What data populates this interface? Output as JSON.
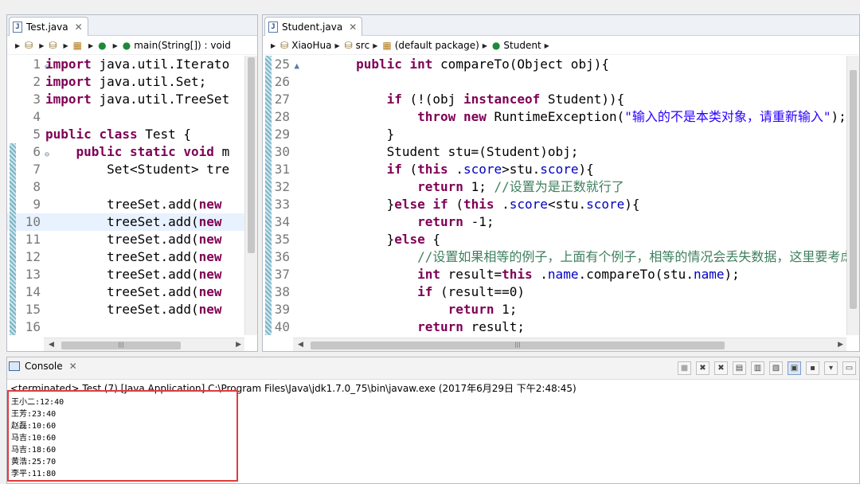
{
  "left_editor": {
    "tab_title": "Test.java",
    "breadcrumb": {
      "last": "main(String[]) : void"
    },
    "lines": [
      {
        "n": "1",
        "t": [
          [
            "kw",
            "import"
          ],
          [
            "",
            "java.util.Iterato"
          ]
        ]
      },
      {
        "n": "2",
        "t": [
          [
            "kw",
            "import"
          ],
          [
            "",
            "java.util.Set;"
          ]
        ]
      },
      {
        "n": "3",
        "t": [
          [
            "kw",
            "import"
          ],
          [
            "",
            "java.util.TreeSet"
          ]
        ]
      },
      {
        "n": "4",
        "t": []
      },
      {
        "n": "5",
        "t": [
          [
            "kw",
            "public"
          ],
          [
            "kw",
            "class"
          ],
          [
            "",
            "Test {"
          ]
        ]
      },
      {
        "n": "6",
        "t": [
          [
            "",
            "    "
          ],
          [
            "kw",
            "public"
          ],
          [
            "kw",
            "static"
          ],
          [
            "kw",
            "void"
          ],
          [
            "",
            "m"
          ]
        ]
      },
      {
        "n": "7",
        "t": [
          [
            "",
            "        Set<Student> tre"
          ]
        ]
      },
      {
        "n": "8",
        "t": []
      },
      {
        "n": "9",
        "t": [
          [
            "",
            "        treeSet.add("
          ],
          [
            "kw",
            "new"
          ]
        ]
      },
      {
        "n": "10",
        "t": [
          [
            "",
            "        treeSet.add("
          ],
          [
            "kw",
            "new"
          ]
        ]
      },
      {
        "n": "11",
        "t": [
          [
            "",
            "        treeSet.add("
          ],
          [
            "kw",
            "new"
          ]
        ]
      },
      {
        "n": "12",
        "t": [
          [
            "",
            "        treeSet.add("
          ],
          [
            "kw",
            "new"
          ]
        ]
      },
      {
        "n": "13",
        "t": [
          [
            "",
            "        treeSet.add("
          ],
          [
            "kw",
            "new"
          ]
        ]
      },
      {
        "n": "14",
        "t": [
          [
            "",
            "        treeSet.add("
          ],
          [
            "kw",
            "new"
          ]
        ]
      },
      {
        "n": "15",
        "t": [
          [
            "",
            "        treeSet.add("
          ],
          [
            "kw",
            "new"
          ]
        ]
      },
      {
        "n": "16",
        "t": []
      }
    ]
  },
  "right_editor": {
    "tab_title": "Student.java",
    "breadcrumb": {
      "project": "XiaoHua",
      "folder": "src",
      "package": "(default package)",
      "class": "Student"
    },
    "lines": [
      {
        "n": "25",
        "t": [
          [
            "",
            "        "
          ],
          [
            "kw",
            "public"
          ],
          [
            "kw",
            "int"
          ],
          [
            "",
            "compareTo(Object obj){"
          ]
        ]
      },
      {
        "n": "26",
        "t": []
      },
      {
        "n": "27",
        "t": [
          [
            "",
            "            "
          ],
          [
            "kw",
            "if"
          ],
          [
            "",
            "(!(obj "
          ],
          [
            "kw",
            "instanceof"
          ],
          [
            "",
            "Student)){"
          ]
        ]
      },
      {
        "n": "28",
        "t": [
          [
            "",
            "                "
          ],
          [
            "kw",
            "throw"
          ],
          [
            "kw",
            "new"
          ],
          [
            "",
            "RuntimeException("
          ],
          [
            "str",
            "\"输入的不是本类对象，请重新输入\""
          ],
          [
            "",
            ");"
          ]
        ]
      },
      {
        "n": "29",
        "t": [
          [
            "",
            "            }"
          ]
        ]
      },
      {
        "n": "30",
        "t": [
          [
            "",
            "            Student stu=(Student)obj;"
          ]
        ]
      },
      {
        "n": "31",
        "t": [
          [
            "",
            "            "
          ],
          [
            "kw",
            "if"
          ],
          [
            "",
            "("
          ],
          [
            "kw",
            "this"
          ],
          [
            "",
            "."
          ],
          [
            "fld",
            "score"
          ],
          [
            "",
            ">stu."
          ],
          [
            "fld",
            "score"
          ],
          [
            "",
            "){"
          ]
        ]
      },
      {
        "n": "32",
        "t": [
          [
            "",
            "                "
          ],
          [
            "kw",
            "return"
          ],
          [
            "",
            "1; "
          ],
          [
            "cm",
            "//设置为是正数就行了"
          ]
        ]
      },
      {
        "n": "33",
        "t": [
          [
            "",
            "            }"
          ],
          [
            "kw",
            "else"
          ],
          [
            "kw",
            "if"
          ],
          [
            "",
            "("
          ],
          [
            "kw",
            "this"
          ],
          [
            "",
            "."
          ],
          [
            "fld",
            "score"
          ],
          [
            "",
            "<stu."
          ],
          [
            "fld",
            "score"
          ],
          [
            "",
            "){"
          ]
        ]
      },
      {
        "n": "34",
        "t": [
          [
            "",
            "                "
          ],
          [
            "kw",
            "return"
          ],
          [
            "",
            "-1;"
          ]
        ]
      },
      {
        "n": "35",
        "t": [
          [
            "",
            "            }"
          ],
          [
            "kw",
            "else"
          ],
          [
            "",
            "{"
          ]
        ]
      },
      {
        "n": "36",
        "t": [
          [
            "",
            "                "
          ],
          [
            "cm",
            "//设置如果相等的例子，上面有个例子，相等的情况会丢失数据，这里要考虑到"
          ]
        ]
      },
      {
        "n": "37",
        "t": [
          [
            "",
            "                "
          ],
          [
            "kw",
            "int"
          ],
          [
            "",
            "result="
          ],
          [
            "kw",
            "this"
          ],
          [
            "",
            "."
          ],
          [
            "fld",
            "name"
          ],
          [
            "",
            ".compareTo(stu."
          ],
          [
            "fld",
            "name"
          ],
          [
            "",
            ");"
          ]
        ]
      },
      {
        "n": "38",
        "t": [
          [
            "",
            "                "
          ],
          [
            "kw",
            "if"
          ],
          [
            "",
            "(result==0)"
          ]
        ]
      },
      {
        "n": "39",
        "t": [
          [
            "",
            "                    "
          ],
          [
            "kw",
            "return"
          ],
          [
            "",
            "1;"
          ]
        ]
      },
      {
        "n": "40",
        "t": [
          [
            "",
            "                "
          ],
          [
            "kw",
            "return"
          ],
          [
            "",
            "result;"
          ]
        ]
      }
    ]
  },
  "console": {
    "tab_title": "Console",
    "status": "<terminated> Test (7) [Java Application] C:\\Program Files\\Java\\jdk1.7.0_75\\bin\\javaw.exe (2017年6月29日 下午2:48:45)",
    "output": [
      "王小二:12:40",
      "王芳:23:40",
      "赵磊:10:60",
      "马吉:10:60",
      "马吉:18:60",
      "黄浩:25:70",
      "李平:11:80"
    ]
  }
}
